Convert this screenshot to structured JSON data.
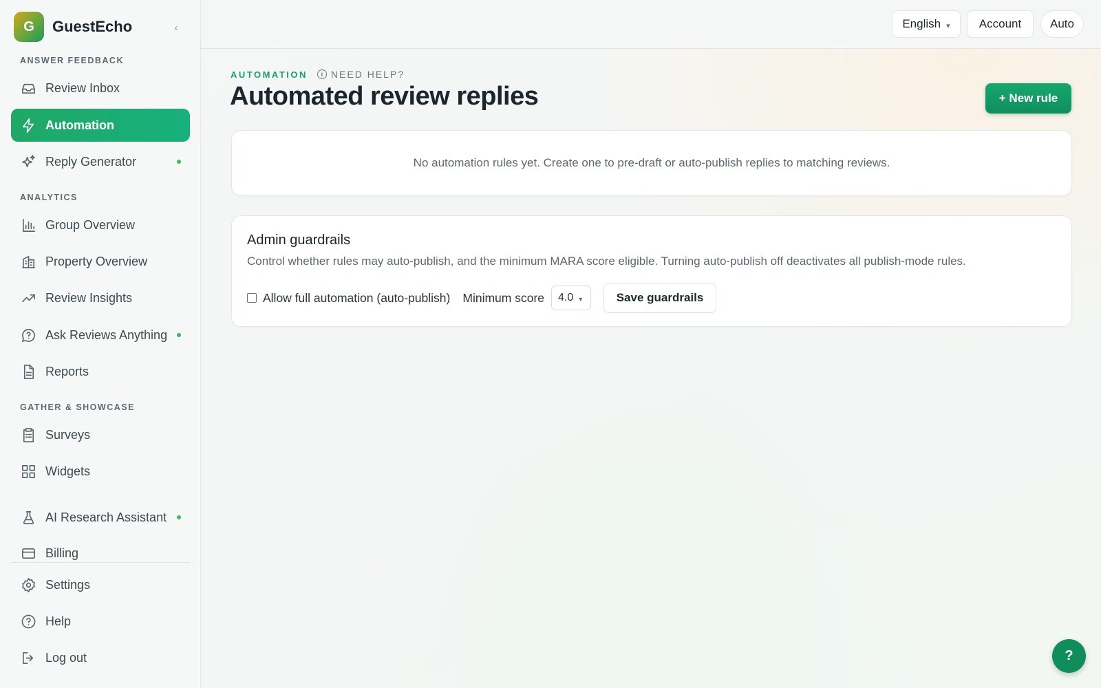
{
  "brand": {
    "logo_letter": "G",
    "name": "GuestEcho",
    "collapse_glyph": "‹"
  },
  "sidebar": {
    "sections": {
      "answer_feedback": "ANSWER FEEDBACK",
      "analytics": "ANALYTICS",
      "gather_showcase": "GATHER & SHOWCASE"
    },
    "items": {
      "review_inbox": {
        "label": "Review Inbox",
        "icon": "inbox-icon"
      },
      "automation": {
        "label": "Automation",
        "icon": "bolt-icon",
        "active": true
      },
      "reply_generator": {
        "label": "Reply Generator",
        "icon": "sparkles-icon",
        "dot": true
      },
      "group_overview": {
        "label": "Group Overview",
        "icon": "bar-chart-icon"
      },
      "property_overview": {
        "label": "Property Overview",
        "icon": "building-icon"
      },
      "review_insights": {
        "label": "Review Insights",
        "icon": "trend-up-icon"
      },
      "ask_reviews": {
        "label": "Ask Reviews Anything",
        "icon": "chat-question-icon",
        "dot": true
      },
      "reports": {
        "label": "Reports",
        "icon": "document-icon"
      },
      "surveys": {
        "label": "Surveys",
        "icon": "clipboard-icon"
      },
      "widgets": {
        "label": "Widgets",
        "icon": "grid-icon"
      },
      "ai_research": {
        "label": "AI Research Assistant",
        "icon": "flask-icon",
        "dot": true
      },
      "billing": {
        "label": "Billing",
        "icon": "card-icon"
      },
      "settings": {
        "label": "Settings",
        "icon": "gear-icon"
      },
      "help": {
        "label": "Help",
        "icon": "help-circle-icon"
      },
      "logout": {
        "label": "Log out",
        "icon": "logout-icon"
      }
    }
  },
  "topbar": {
    "language": "English",
    "account": "Account",
    "theme": "Auto"
  },
  "main": {
    "eyebrow": "AUTOMATION",
    "need_help": "NEED HELP?",
    "title": "Automated review replies",
    "new_rule": "+ New rule",
    "empty_state": "No automation rules yet. Create one to pre-draft or auto-publish replies to matching reviews.",
    "guardrails": {
      "title": "Admin guardrails",
      "description": "Control whether rules may auto-publish, and the minimum MARA score eligible. Turning auto-publish off deactivates all publish-mode rules.",
      "checkbox_label": "Allow full automation (auto-publish)",
      "checkbox_checked": false,
      "min_score_label": "Minimum score",
      "min_score_value": "4.0",
      "save_label": "Save guardrails"
    }
  },
  "help_fab": "?",
  "colors": {
    "accent": "#17a86e",
    "accent_dark": "#0f8e5c",
    "dot": "#3fb85f"
  }
}
